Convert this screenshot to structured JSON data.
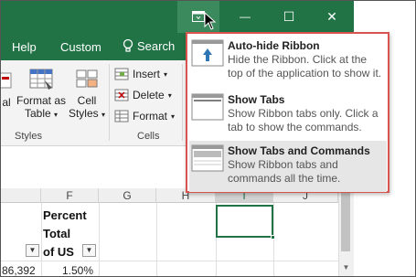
{
  "titlebar": {
    "ribbon_options": "ribbon-display-options-icon",
    "minimize": "—",
    "maximize": "☐",
    "close": "✕"
  },
  "tabs": {
    "help": "Help",
    "custom": "Custom",
    "tell_me": "Search"
  },
  "ribbon": {
    "styles": {
      "conditional": "al",
      "format_as_table_line1": "Format as",
      "format_as_table_line2": "Table",
      "cell_styles_line1": "Cell",
      "cell_styles_line2": "Styles",
      "group_label": "Styles"
    },
    "cells": {
      "insert": "Insert",
      "delete": "Delete",
      "format": "Format",
      "group_label": "Cells"
    }
  },
  "sheet": {
    "columns": [
      "F",
      "G",
      "H",
      "I",
      "J"
    ],
    "selected_column": "I",
    "header_cell_lines": [
      "Percent",
      "Total",
      "of US"
    ],
    "row_values": {
      "e": "86,392",
      "f": "1.50%"
    }
  },
  "menu": {
    "items": [
      {
        "title": "Auto-hide Ribbon",
        "desc": "Hide the Ribbon. Click at the top of the application to show it.",
        "icon": "auto-hide-ribbon-icon"
      },
      {
        "title": "Show Tabs",
        "desc": "Show Ribbon tabs only. Click a tab to show the commands.",
        "icon": "show-tabs-icon"
      },
      {
        "title": "Show Tabs and Commands",
        "desc": "Show Ribbon tabs and commands all the time.",
        "icon": "show-tabs-commands-icon"
      }
    ]
  },
  "colors": {
    "excel_green": "#217346",
    "highlight_border": "#d9534f"
  }
}
